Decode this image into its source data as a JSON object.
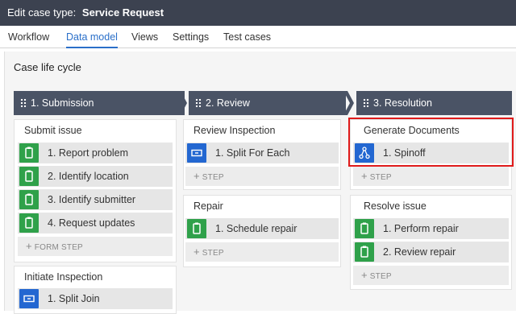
{
  "window": {
    "title_prefix": "Edit case type:",
    "title_name": "Service Request"
  },
  "tabs": [
    "Workflow",
    "Data model",
    "Views",
    "Settings",
    "Test cases"
  ],
  "active_tab": "Data model",
  "section_title": "Case life cycle",
  "stages": [
    {
      "label": "1.  Submission",
      "processes": [
        {
          "title": "Submit issue",
          "steps": [
            {
              "label": "1.   Report problem",
              "icon": "form-icon",
              "color": "#2fa14a"
            },
            {
              "label": "2.   Identify location",
              "icon": "form-icon",
              "color": "#2fa14a"
            },
            {
              "label": "3.   Identify submitter",
              "icon": "form-icon",
              "color": "#2fa14a"
            },
            {
              "label": "4.   Request updates",
              "icon": "form-icon",
              "color": "#2fa14a"
            }
          ],
          "add_label": "FORM STEP"
        },
        {
          "title": "Initiate Inspection",
          "steps": [
            {
              "label": "1.   Split Join",
              "icon": "split-icon",
              "color": "#2367d1"
            }
          ]
        }
      ]
    },
    {
      "label": "2.  Review",
      "processes": [
        {
          "title": "Review Inspection",
          "steps": [
            {
              "label": "1.   Split For Each",
              "icon": "split-icon",
              "color": "#2367d1"
            }
          ],
          "add_label": "STEP"
        },
        {
          "title": "Repair",
          "steps": [
            {
              "label": "1.   Schedule repair",
              "icon": "form-icon",
              "color": "#2fa14a"
            }
          ],
          "add_label": "STEP"
        }
      ]
    },
    {
      "label": "3.  Resolution",
      "processes": [
        {
          "title": "Generate Documents",
          "steps": [
            {
              "label": "1.   Spinoff",
              "icon": "spinoff-icon",
              "color": "#2367d1"
            }
          ],
          "add_label": "STEP"
        },
        {
          "title": "Resolve issue",
          "steps": [
            {
              "label": "1.   Perform repair",
              "icon": "form-icon",
              "color": "#2fa14a"
            },
            {
              "label": "2.   Review repair",
              "icon": "form-icon",
              "color": "#2fa14a"
            }
          ],
          "add_label": "STEP"
        }
      ]
    }
  ],
  "colors": {
    "header_bg": "#3c4250",
    "stage_bg": "#4a5365",
    "accent": "#2a6fc9",
    "highlight": "#e01b1b"
  }
}
